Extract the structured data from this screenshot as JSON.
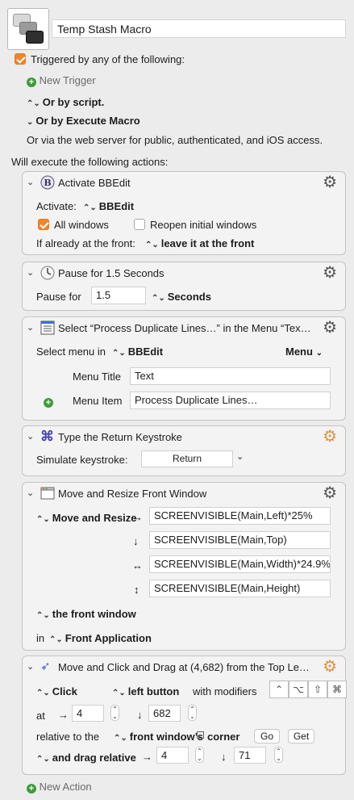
{
  "macro": {
    "name": "Temp Stash Macro",
    "icon": "stacked-windows-icon"
  },
  "triggers": {
    "triggered_label": "Triggered by any of the following:",
    "new_trigger": "New Trigger",
    "or_by_script": "Or by script.",
    "or_by_execute": "Or by Execute Macro",
    "web_server": "Or via the web server for public, authenticated, and iOS access."
  },
  "actions_header": "Will execute the following actions:",
  "actions": {
    "activate": {
      "title": "Activate BBEdit",
      "activate_label": "Activate:",
      "app": "BBEdit",
      "all_windows": "All windows",
      "reopen": "Reopen initial windows",
      "front_label": "If already at the front:",
      "front_option": "leave it at the front"
    },
    "pause": {
      "title": "Pause for 1.5 Seconds",
      "label": "Pause for",
      "value": "1.5",
      "unit": "Seconds"
    },
    "menu": {
      "title": "Select “Process Duplicate Lines…” in the Menu “Tex…",
      "select_label": "Select menu in",
      "app": "BBEdit",
      "menu_dropdown": "Menu",
      "menu_title_label": "Menu Title",
      "menu_title_value": "Text",
      "menu_item_label": "Menu Item",
      "menu_item_value": "Process Duplicate Lines…"
    },
    "keystroke": {
      "title": "Type the Return Keystroke",
      "label": "Simulate keystroke:",
      "value": "Return"
    },
    "move_resize": {
      "title": "Move and Resize Front Window",
      "mode": "Move and Resize",
      "left": "SCREENVISIBLE(Main,Left)*25%",
      "top": "SCREENVISIBLE(Main,Top)",
      "width": "SCREENVISIBLE(Main,Width)*24.9%",
      "height": "SCREENVISIBLE(Main,Height)",
      "target": "the front window",
      "in_label": "in",
      "app": "Front Application"
    },
    "click": {
      "title": "Move and Click and Drag at (4,682) from the Top Le…",
      "action": "Click",
      "button": "left button",
      "modifiers_label": "with modifiers",
      "at_label": "at",
      "x": "4",
      "y": "682",
      "relative_label": "relative to the",
      "relative_option": "front window’s",
      "corner_label": "corner",
      "go": "Go",
      "get": "Get",
      "drag_label": "and drag relative",
      "drag_x": "4",
      "drag_y": "71"
    }
  },
  "new_action": "New Action",
  "colors": {
    "accent": "#f0852a",
    "add_green": "#3f9b3a",
    "card_bg": "#f3f3f3",
    "window_bg": "#ececec"
  }
}
